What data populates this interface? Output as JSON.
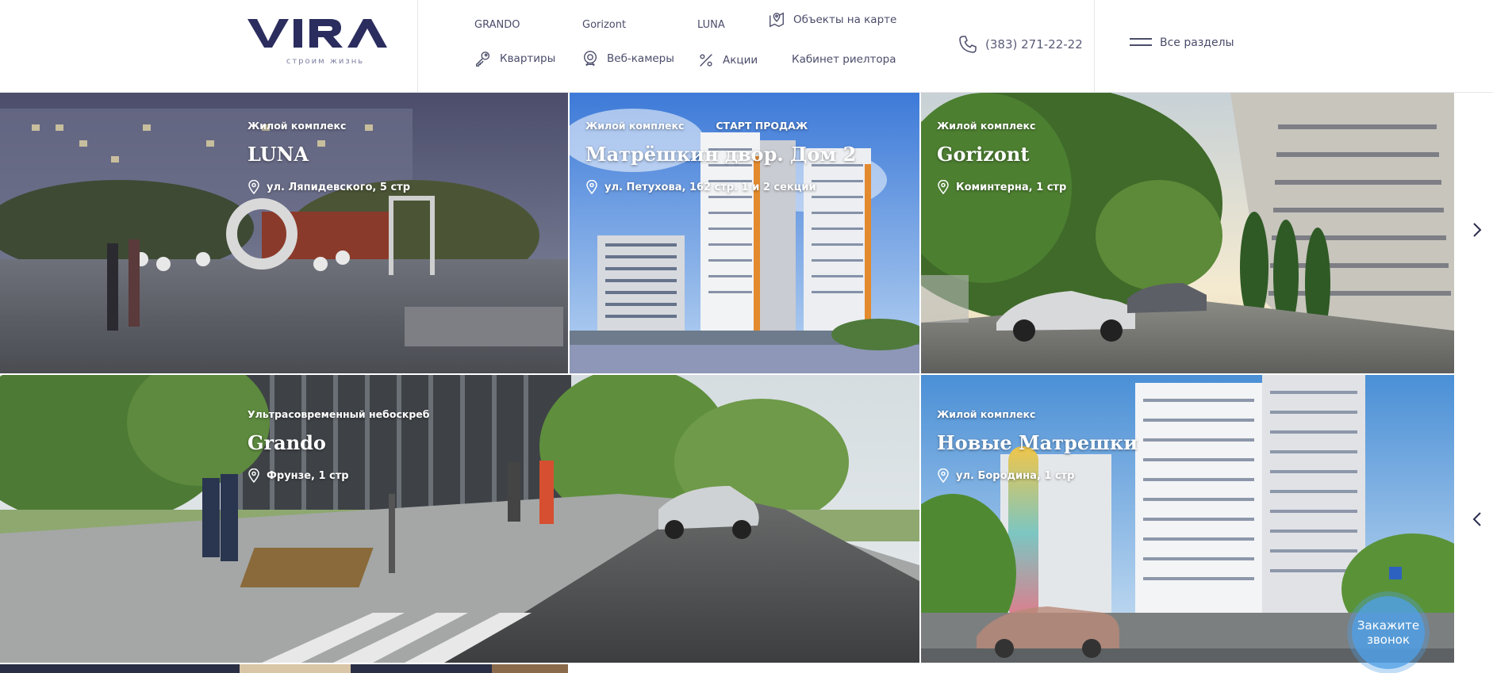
{
  "brand": {
    "name": "VIRA",
    "tagline": "строим жизнь",
    "color": "#2b2d5e"
  },
  "nav": {
    "top_links": [
      {
        "label": "GRANDO"
      },
      {
        "label": "Gorizont"
      },
      {
        "label": "LUNA"
      }
    ],
    "map_link": {
      "label": "Объекты на карте",
      "icon": "map-pin-icon"
    },
    "items": [
      {
        "label": "Квартиры",
        "icon": "key-icon"
      },
      {
        "label": "Веб-камеры",
        "icon": "webcam-icon"
      },
      {
        "label": "Акции",
        "icon": "percent-icon"
      },
      {
        "label": "Кабинет риелтора"
      }
    ]
  },
  "phone": {
    "number": "(383) 271-22-22",
    "icon": "phone-icon"
  },
  "menu": {
    "label": "Все разделы",
    "icon": "burger-icon"
  },
  "tiles": [
    {
      "kind": "Жилой комплекс",
      "badge": "",
      "title": "LUNA",
      "address": "ул. Ляпидевского, 5 стр"
    },
    {
      "kind": "Жилой комплекс",
      "badge": "СТАРТ ПРОДАЖ",
      "title": "Матрёшкин двор. Дом 2",
      "address": "ул. Петухова, 162 стр. 1 и 2 секции"
    },
    {
      "kind": "Жилой комплекс",
      "badge": "",
      "title": "Gorizont",
      "address": "Коминтерна, 1 стр"
    },
    {
      "kind": "Ультрасовременный небоскреб",
      "badge": "",
      "title": "Grando",
      "address": "Фрунзе, 1 стр"
    },
    {
      "kind": "Жилой комплекс",
      "badge": "",
      "title": "Новые Матрешки",
      "address": "ул. Бородина, 1 стр"
    }
  ],
  "callback": {
    "label": "Закажите звонок"
  },
  "colors": {
    "accent": "#2b2d5e",
    "callback": "#50a0e6",
    "text": "#4a4c6a"
  }
}
